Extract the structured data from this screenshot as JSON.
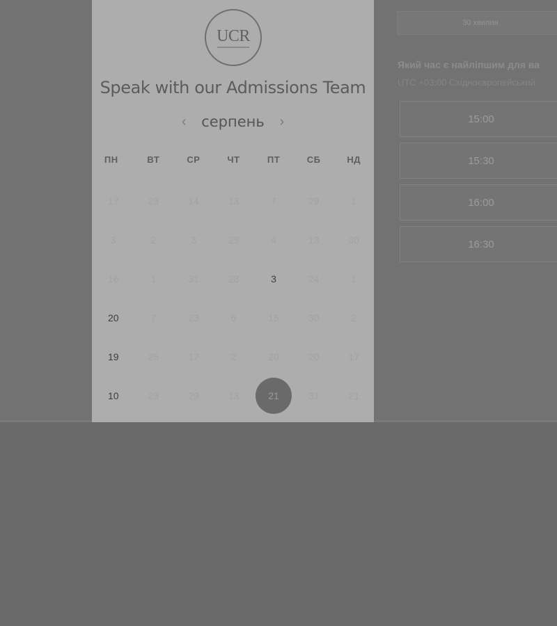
{
  "logo": {
    "text": "UCR"
  },
  "panel": {
    "title": "Speak with our Admissions Team"
  },
  "calendar": {
    "month": "серпень",
    "weekdays": [
      "ПН",
      "ВТ",
      "СР",
      "ЧТ",
      "ПТ",
      "СБ",
      "НД"
    ],
    "weeks": [
      [
        "17",
        "23",
        "14",
        "13",
        "7",
        "29",
        "1"
      ],
      [
        "3",
        "2",
        "3",
        "29",
        "4",
        "13",
        "30"
      ],
      [
        "16",
        "1",
        "31",
        "28",
        "3",
        "24",
        "1"
      ],
      [
        "20",
        "7",
        "23",
        "6",
        "15",
        "30",
        "2"
      ],
      [
        "19",
        "25",
        "17",
        "2",
        "20",
        "20",
        "17"
      ],
      [
        "10",
        "23",
        "29",
        "13",
        "21",
        "31",
        "21"
      ]
    ],
    "selected": "21"
  },
  "booking": {
    "duration": "30 хвилин",
    "question": "Який час є найліпшим для ва",
    "timezone": "UTC +03:00 Східноєвропейський",
    "slots": [
      "15:00",
      "15:30",
      "16:00",
      "16:30"
    ]
  },
  "colors": {
    "overlay_background": "#6a6a6a",
    "panel_background": "#adadad",
    "selected_day": "#6a6a6a"
  }
}
